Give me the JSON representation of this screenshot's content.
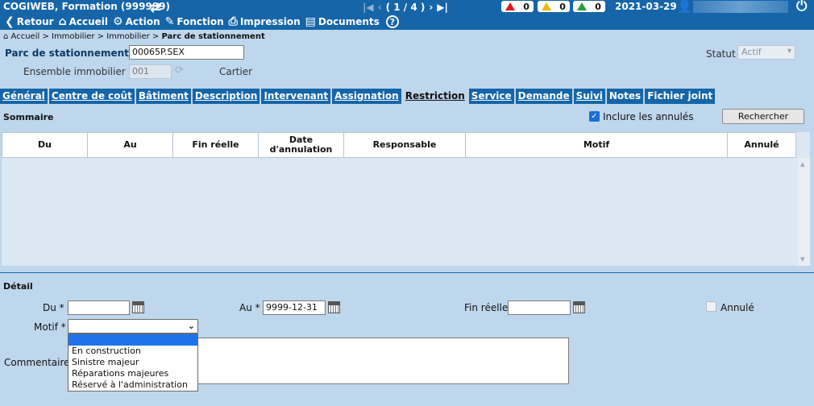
{
  "header": {
    "app_title": "COGIWEB, Formation (999999)",
    "pager": "( 1 / 4 )",
    "date": "2021-03-29",
    "alerts": [
      {
        "count": "0",
        "color": "#e01a1a"
      },
      {
        "count": "0",
        "color": "#f2b705"
      },
      {
        "count": "0",
        "color": "#2a9d3a"
      }
    ]
  },
  "toolbar": {
    "back": "Retour",
    "home": "Accueil",
    "action": "Action",
    "function": "Fonction",
    "print": "Impression",
    "documents": "Documents",
    "help": "?"
  },
  "breadcrumb": {
    "path": "Accueil > Immobilier > Immobilier > ",
    "current": "Parc de stationnement"
  },
  "form": {
    "parc_label": "Parc de stationnement *",
    "parc_value": "00065P.SEX",
    "ensemble_label": "Ensemble immobilier *",
    "ensemble_value": "001",
    "cartier_label": "Cartier",
    "statut_label": "Statut",
    "statut_value": "Actif"
  },
  "tabs": [
    {
      "label": "Général"
    },
    {
      "label": "Centre de coût"
    },
    {
      "label": "Bâtiment"
    },
    {
      "label": "Description"
    },
    {
      "label": "Intervenant"
    },
    {
      "label": "Assignation"
    },
    {
      "label": "Restriction"
    },
    {
      "label": "Service"
    },
    {
      "label": "Demande"
    },
    {
      "label": "Suivi"
    },
    {
      "label": "Notes"
    },
    {
      "label": "Fichier joint"
    }
  ],
  "sommaire": {
    "title": "Sommaire",
    "include_cancelled_label": "Inclure les annulés",
    "search_button": "Rechercher",
    "columns": [
      "Du",
      "Au",
      "Fin réelle",
      "Date d'annulation",
      "Responsable",
      "Motif",
      "Annulé"
    ]
  },
  "detail": {
    "title": "Détail",
    "du_label": "Du *",
    "du_value": "",
    "au_label": "Au *",
    "au_value": "9999-12-31",
    "fin_label": "Fin réelle",
    "fin_value": "",
    "annule_label": "Annulé",
    "motif_label": "Motif *",
    "commentaire_label": "Commentaire",
    "motif_options": [
      "",
      "En construction",
      "Sinistre majeur",
      "Réparations majeures",
      "Réservé à l'administration"
    ]
  }
}
